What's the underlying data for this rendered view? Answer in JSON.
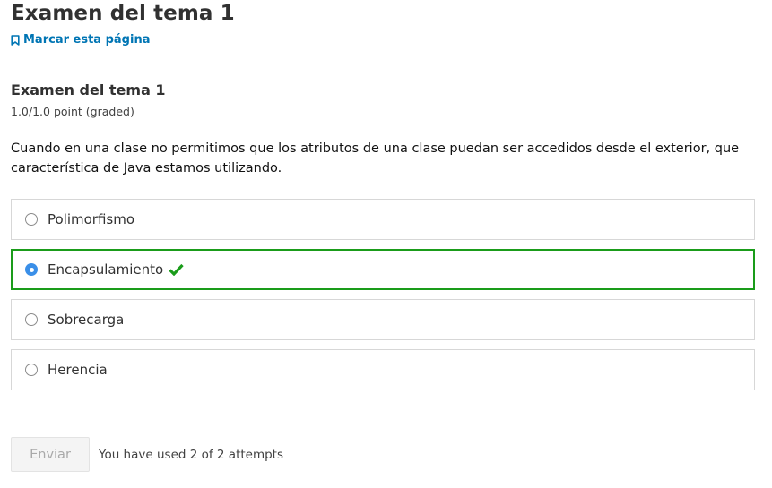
{
  "page": {
    "title": "Examen del tema 1",
    "bookmark_label": "Marcar esta página"
  },
  "problem": {
    "title": "Examen del tema 1",
    "points": "1.0/1.0 point (graded)",
    "question": "Cuando en una clase no permitimos que los atributos de una clase puedan ser accedidos desde el exterior, que característica de Java estamos utilizando.",
    "options": [
      {
        "label": "Polimorfismo",
        "selected": false,
        "correct": false
      },
      {
        "label": "Encapsulamiento",
        "selected": true,
        "correct": true
      },
      {
        "label": "Sobrecarga",
        "selected": false,
        "correct": false
      },
      {
        "label": "Herencia",
        "selected": false,
        "correct": false
      }
    ]
  },
  "submit": {
    "button_label": "Enviar",
    "attempts_text": "You have used 2 of 2 attempts"
  },
  "colors": {
    "link": "#0075b4",
    "correct": "#1a9c1a",
    "radio_selected": "#3a8fe8"
  },
  "icons": {
    "bookmark": "bookmark-icon",
    "correct": "checkmark-icon"
  }
}
